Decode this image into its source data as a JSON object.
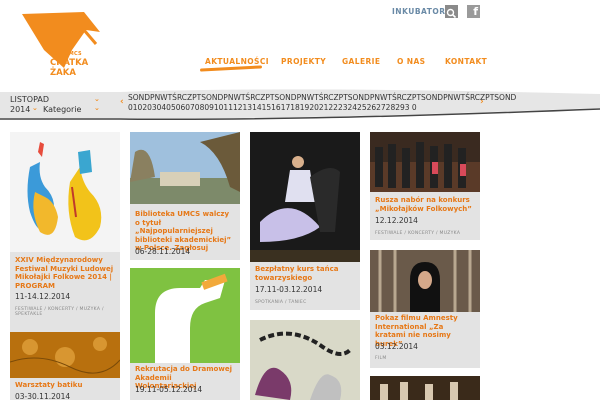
{
  "logo": {
    "small": "ACK UMCS",
    "line1": "CHATKA",
    "line2": "ŻAKA"
  },
  "top": {
    "inkubator": "INKUBATOR",
    "search_icon": "search-icon",
    "facebook_icon": "facebook-icon",
    "facebook_glyph": "f"
  },
  "nav": {
    "items": [
      "AKTUALNOŚCI",
      "PROJEKTY",
      "GALERIE",
      "O NAS",
      "KONTAKT"
    ],
    "active": 0
  },
  "calendar": {
    "month": "LISTOPAD",
    "year": "2014",
    "category": "Kategorie",
    "prev_arrow": "‹",
    "next_arrow": "›",
    "weekdays": "SONDPNWTŚRCZPTSONDPNWTŚRCZPTSONDPNWTŚRCZPTSONDPNWTŚRCZPTSONDPNWTŚRCZPTSOND",
    "days": "01020304050607080910111213141516171819202122232425262728293 0"
  },
  "tiles": [
    {
      "title": "XXIV Międzynarodowy Festiwal Muzyki Ludowej Mikołajki Folkowe 2014 | PROGRAM",
      "date": "11-14.12.2014",
      "category": "FESTIWALE / KONCERTY / MUZYKA / SPEKTAKLE"
    },
    {
      "title": "Biblioteka UMCS walczy o tytuł „Najpopularniejszej biblioteki akademickiej” w Polsce. Zagłosuj",
      "date": "06-28.11.2014",
      "category": ""
    },
    {
      "title": "Bezpłatny kurs tańca towarzyskiego",
      "date": "17.11-03.12.2014",
      "category": "SPOTKANIA / TANIEC"
    },
    {
      "title": "Rusza nabór na konkurs „Mikołajków Folkowych”",
      "date": "12.12.2014",
      "category": "FESTIWALE / KONCERTY / MUZYKA"
    },
    {
      "title": "Rekrutacja do Dramowej Akademii Wolontariackiej",
      "date": "19.11-05.12.2014",
      "category": ""
    },
    {
      "title": "Pokaz filmu Amnesty International „Za kratami nie nosimy burek”",
      "date": "03.12.2014",
      "category": "FILM"
    },
    {
      "title": "Warsztaty batiku",
      "date": "03-30.11.2014",
      "category": ""
    }
  ],
  "colors": {
    "accent": "#f28c1e",
    "tile_bg": "#e3e3e3",
    "title_text": "#e67817"
  }
}
